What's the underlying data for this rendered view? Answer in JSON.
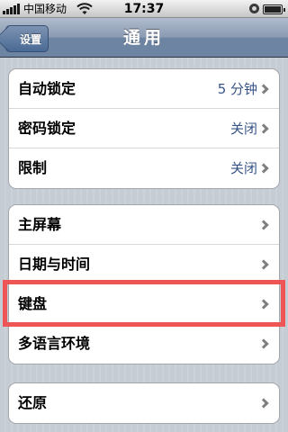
{
  "status_bar": {
    "carrier": "中国移动",
    "time": "17:37",
    "battery_level": 1.0
  },
  "nav_bar": {
    "back_label": "设置",
    "title": "通用"
  },
  "groups": [
    {
      "rows": [
        {
          "label": "自动锁定",
          "value": "5 分钟"
        },
        {
          "label": "密码锁定",
          "value": "关闭"
        },
        {
          "label": "限制",
          "value": "关闭"
        }
      ]
    },
    {
      "rows": [
        {
          "label": "主屏幕"
        },
        {
          "label": "日期与时间"
        },
        {
          "label": "键盘"
        },
        {
          "label": "多语言环境"
        }
      ]
    },
    {
      "rows": [
        {
          "label": "还原"
        }
      ]
    }
  ],
  "highlight": {
    "row": "键盘",
    "color": "#ee5555"
  },
  "icons": [
    "signal-icon",
    "wifi-icon",
    "lock-rotation-icon",
    "battery-icon",
    "back-arrow-icon",
    "chevron-right-icon"
  ]
}
